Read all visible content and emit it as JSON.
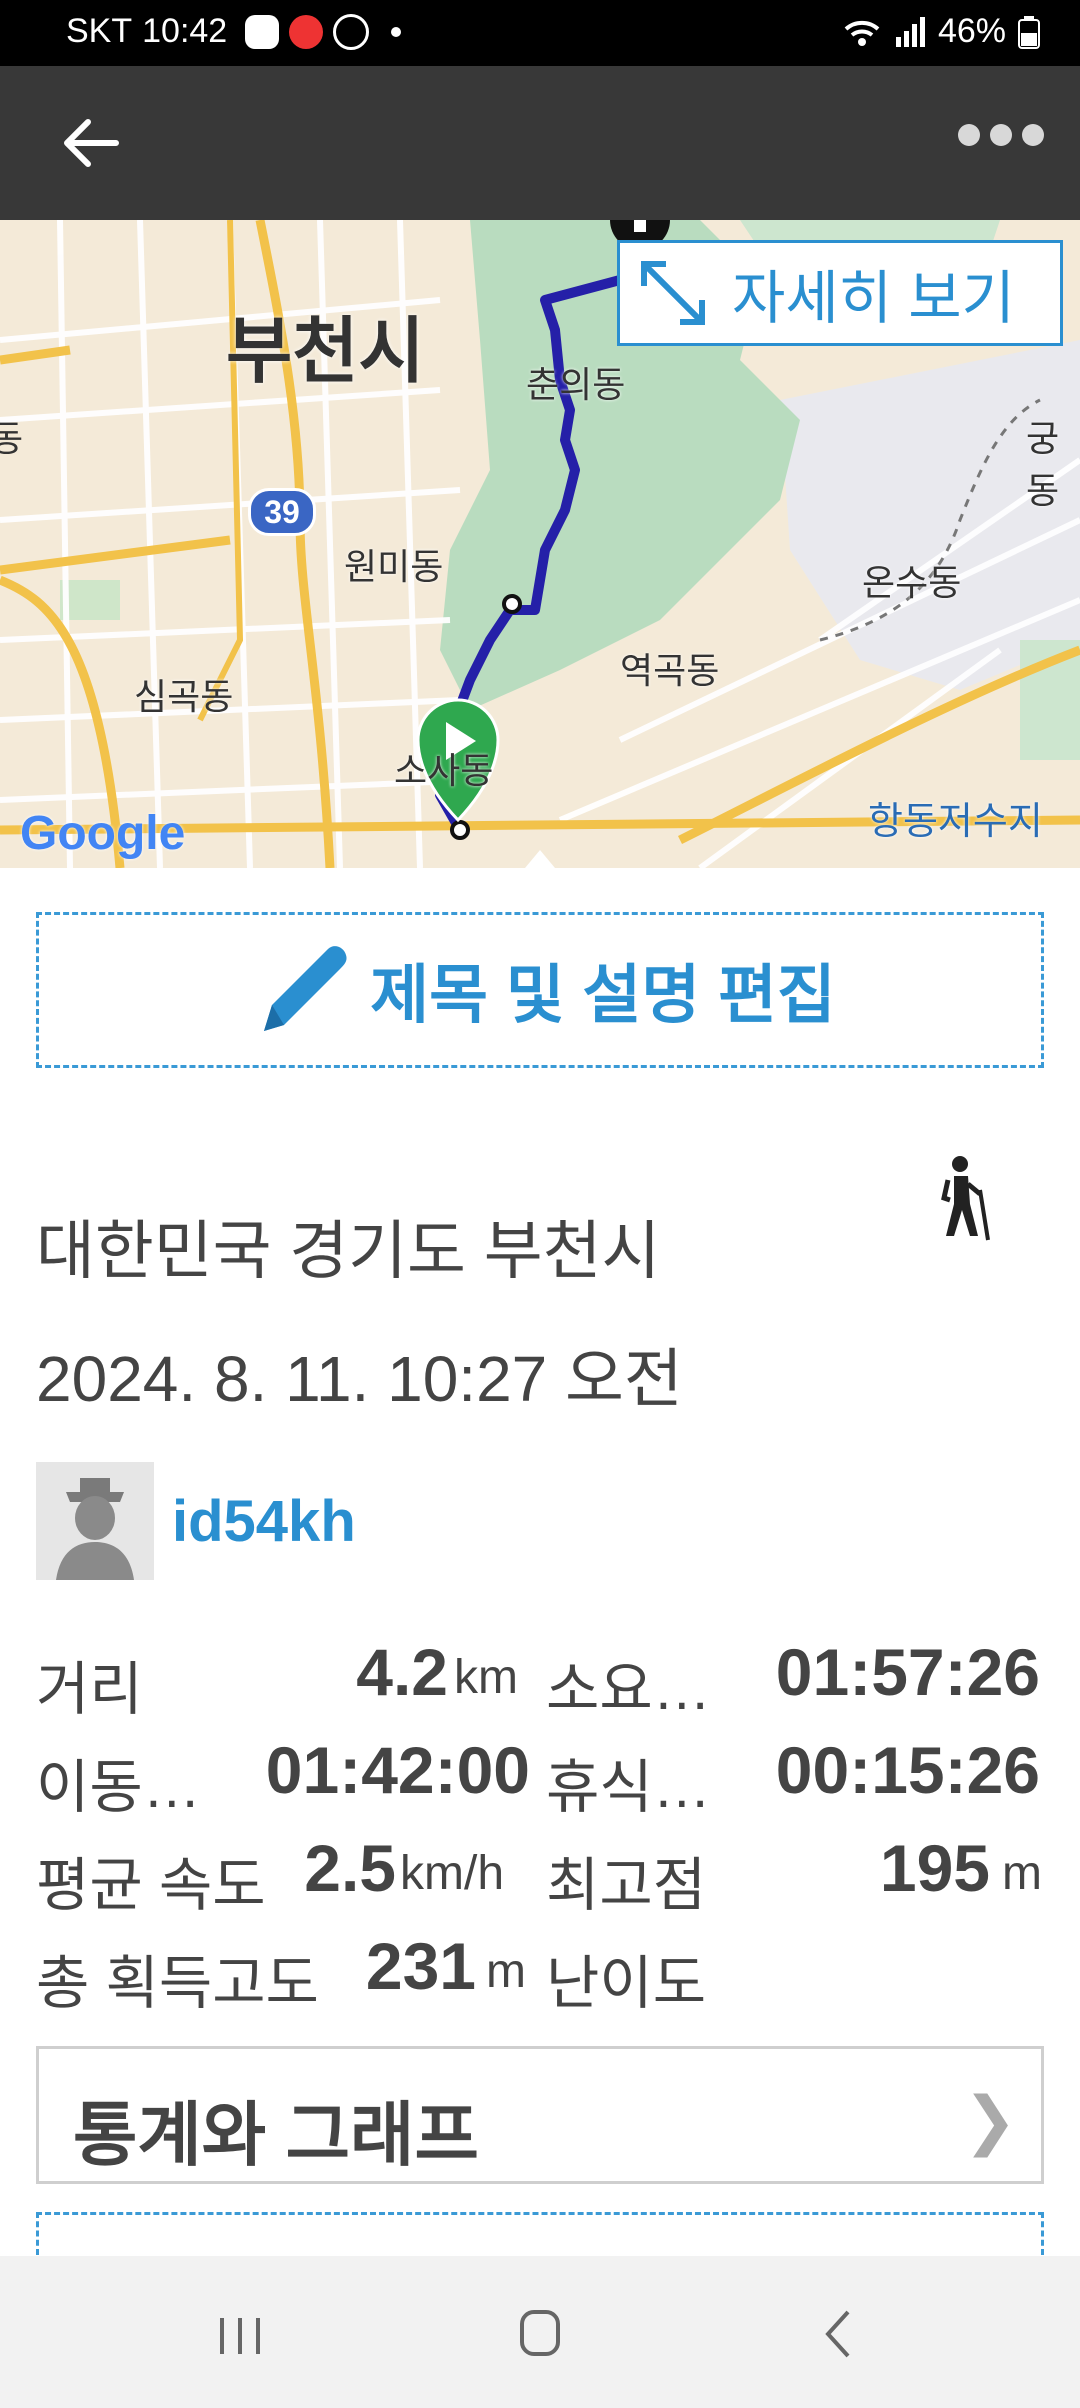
{
  "status_bar": {
    "carrier": "SKT",
    "time": "10:42",
    "battery": "46%"
  },
  "map": {
    "city_label": "부천시",
    "route_badge": "39",
    "labels": {
      "chunui": "춘의동",
      "wonmi": "원미동",
      "yeokgok": "역곡동",
      "simgok": "심곡동",
      "onsu": "온수동",
      "sosa": "소사동",
      "gung": "궁동",
      "dong_left": "동",
      "hangdong": "항동저수지"
    },
    "google": "Google",
    "detail_button": "자세히 보기"
  },
  "edit_button": "제목 및 설명 편집",
  "activity": {
    "location": "대한민국 경기도 부천시",
    "datetime": "2024. 8. 11. 10:27 오전",
    "username": "id54kh"
  },
  "stats": {
    "distance_label": "거리",
    "distance_value": "4.2",
    "distance_unit": "km",
    "elapsed_label": "소요…",
    "elapsed_value": "01:57:26",
    "moving_label": "이동…",
    "moving_value": "01:42:00",
    "rest_label": "휴식…",
    "rest_value": "00:15:26",
    "avg_speed_label": "평균 속도",
    "avg_speed_value": "2.5",
    "avg_speed_unit": "km/h",
    "max_alt_label": "최고점",
    "max_alt_value": "195",
    "max_alt_unit": "m",
    "gain_label": "총 획득고도",
    "gain_value": "231",
    "gain_unit": "m",
    "difficulty_label": "난이도"
  },
  "stats_button": "통계와 그래프",
  "colors": {
    "accent": "#2a8fd0",
    "app_bar": "#383838",
    "route": "#2520a8",
    "start_marker": "#2fa84f"
  }
}
